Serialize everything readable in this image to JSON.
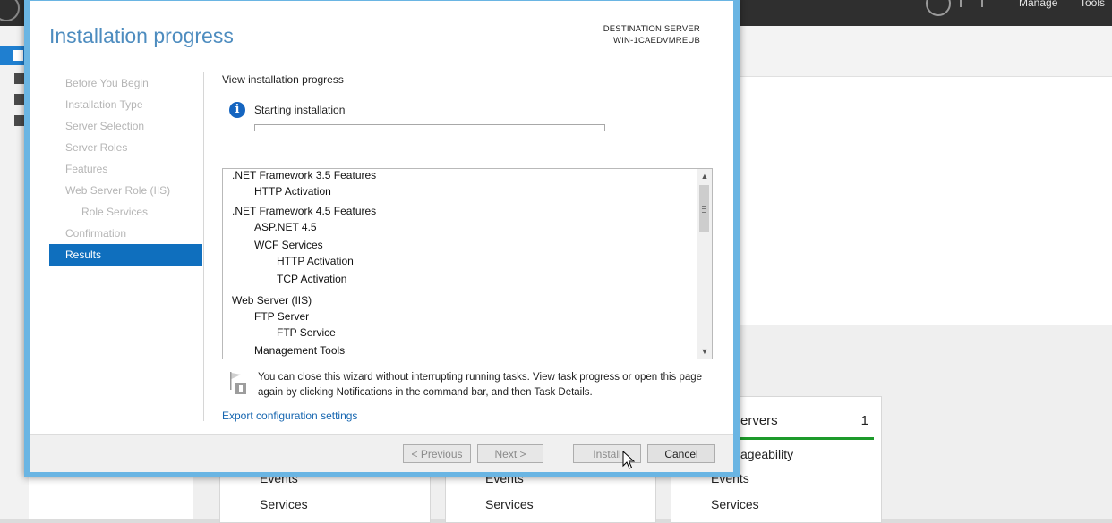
{
  "wizard": {
    "title": "Installation progress",
    "destination_label": "DESTINATION SERVER",
    "destination_server": "WIN-1CAEDVMREUB",
    "nav": [
      {
        "label": "Before You Begin",
        "sub": false,
        "active": false
      },
      {
        "label": "Installation Type",
        "sub": false,
        "active": false
      },
      {
        "label": "Server Selection",
        "sub": false,
        "active": false
      },
      {
        "label": "Server Roles",
        "sub": false,
        "active": false
      },
      {
        "label": "Features",
        "sub": false,
        "active": false
      },
      {
        "label": "Web Server Role (IIS)",
        "sub": false,
        "active": false
      },
      {
        "label": "Role Services",
        "sub": true,
        "active": false
      },
      {
        "label": "Confirmation",
        "sub": false,
        "active": false
      },
      {
        "label": "Results",
        "sub": false,
        "active": true
      }
    ],
    "content_heading": "View installation progress",
    "status": "Starting installation",
    "progress": 0,
    "features": [
      {
        "label": ".NET Framework 3.5 Features",
        "level": 0
      },
      {
        "label": "HTTP Activation",
        "level": 1
      },
      {
        "label": ".NET Framework 4.5 Features",
        "level": 0
      },
      {
        "label": "ASP.NET 4.5",
        "level": 1
      },
      {
        "label": "WCF Services",
        "level": 1
      },
      {
        "label": "HTTP Activation",
        "level": 2
      },
      {
        "label": "TCP Activation",
        "level": 2
      },
      {
        "label": "Web Server (IIS)",
        "level": 0
      },
      {
        "label": "FTP Server",
        "level": 1
      },
      {
        "label": "FTP Service",
        "level": 2
      },
      {
        "label": "Management Tools",
        "level": 1
      }
    ],
    "note": "You can close this wizard without interrupting running tasks. View task progress or open this page again by clicking Notifications in the command bar, and then Task Details.",
    "export_link": "Export configuration settings",
    "buttons": {
      "previous": "< Previous",
      "next": "Next >",
      "install": "Install",
      "cancel": "Cancel"
    }
  },
  "background": {
    "menu": [
      "Manage",
      "Tools"
    ],
    "tiles": [
      {
        "title": "",
        "count": "",
        "lines": [
          "Events",
          "Services"
        ]
      },
      {
        "title": "",
        "count": "",
        "lines": [
          "Events",
          "Services"
        ]
      },
      {
        "title": "ervers",
        "count": "1",
        "lines": [
          "ageability",
          "Events",
          "Services"
        ]
      }
    ]
  }
}
